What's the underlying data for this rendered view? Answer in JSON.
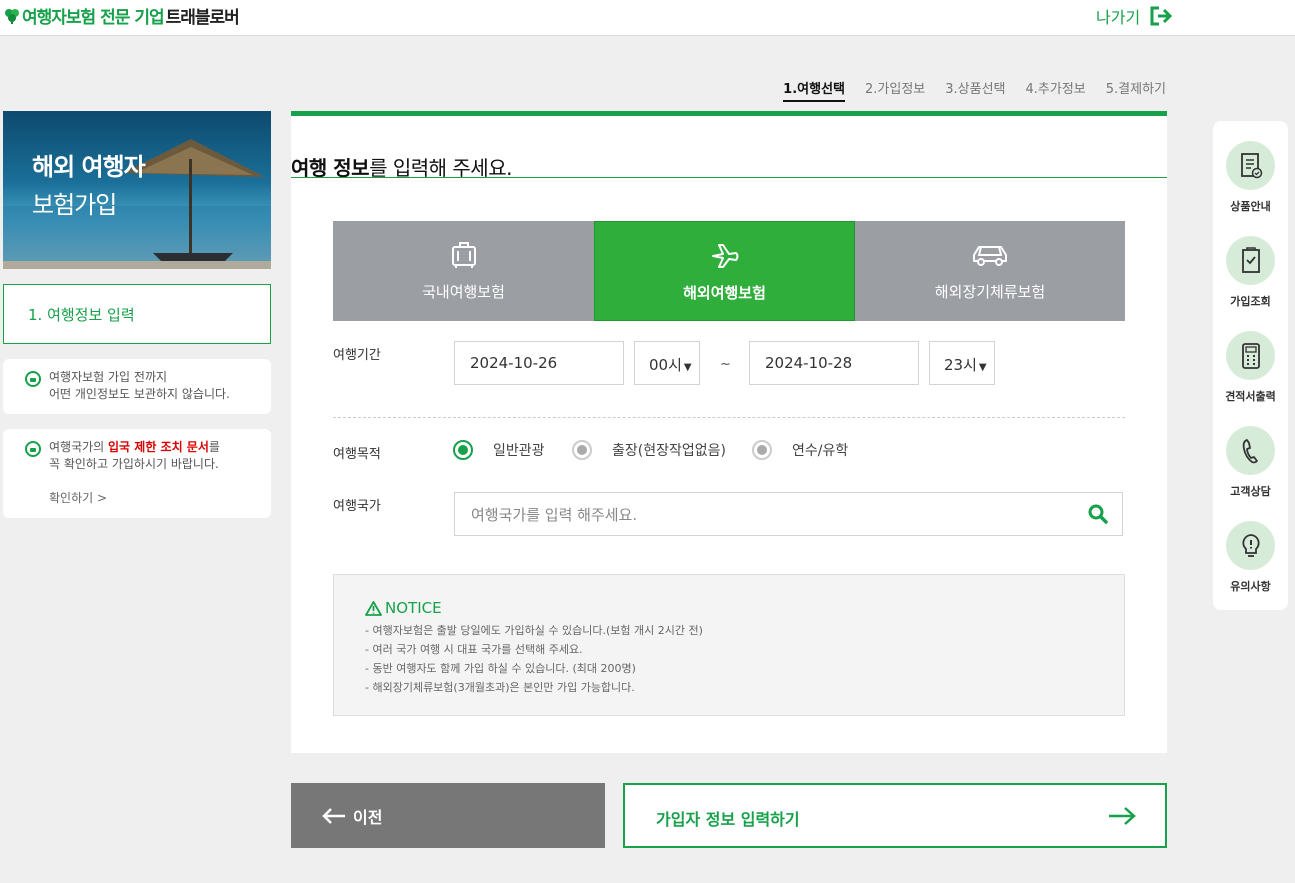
{
  "header": {
    "logo_green": "여행자보험 전문 기업",
    "logo_black": "트래블로버",
    "exit_label": "나가기"
  },
  "steps": [
    "1.여행선택",
    "2.가입정보",
    "3.상품선택",
    "4.추가정보",
    "5.결제하기"
  ],
  "active_step": 0,
  "sidebar": {
    "banner_line1": "해외 여행자",
    "banner_line2": "보험가입",
    "nav_item": "1. 여행정보 입력",
    "info1": {
      "line1": "여행자보험 가입 전까지",
      "line2": "어떤 개인정보도 보관하지 않습니다."
    },
    "info2": {
      "prefix": "여행국가의 ",
      "highlight": "입국 제한 조치 문서",
      "suffix": "를",
      "line2": "꼭 확인하고 가입하시기 바랍니다.",
      "link": "확인하기 >"
    }
  },
  "main": {
    "title_bold": "여행 정보",
    "title_rest": "를 입력해 주세요.",
    "tabs": [
      {
        "label": "국내여행보험",
        "icon": "luggage-icon",
        "active": false
      },
      {
        "label": "해외여행보험",
        "icon": "airplane-icon",
        "active": true
      },
      {
        "label": "해외장기체류보험",
        "icon": "car-icon",
        "active": false
      }
    ],
    "period": {
      "label": "여행기간",
      "start_date": "2024-10-26",
      "start_hour": "00시",
      "separator": "~",
      "end_date": "2024-10-28",
      "end_hour": "23시"
    },
    "purpose": {
      "label": "여행목적",
      "options": [
        "일반관광",
        "출장(현장작업없음)",
        "연수/유학"
      ],
      "selected": 0
    },
    "country": {
      "label": "여행국가",
      "placeholder": "여행국가를 입력 해주세요."
    },
    "notice": {
      "title": "NOTICE",
      "items": [
        "- 여행자보험은 출발 당일에도 가입하실 수 있습니다.(보험 개시 2시간 전)",
        "- 여러 국가 여행 시 대표 국가를 선택해 주세요.",
        "- 동반 여행자도 함께 가입 하실 수 있습니다. (최대 200명)",
        "- 해외장기체류보험(3개월초과)은 본인만 가입 가능합니다."
      ]
    }
  },
  "buttons": {
    "prev": "이전",
    "next": "가입자 정보 입력하기"
  },
  "quick_menu": [
    {
      "label": "상품안내",
      "icon": "document-icon"
    },
    {
      "label": "가입조회",
      "icon": "checklist-icon"
    },
    {
      "label": "견적서출력",
      "icon": "calculator-icon"
    },
    {
      "label": "고객상담",
      "icon": "phone-icon"
    },
    {
      "label": "유의사항",
      "icon": "lightbulb-icon"
    }
  ],
  "colors": {
    "accent": "#17a14a",
    "tab_active": "#2fae3c",
    "tab_inactive": "#9b9ea3"
  }
}
